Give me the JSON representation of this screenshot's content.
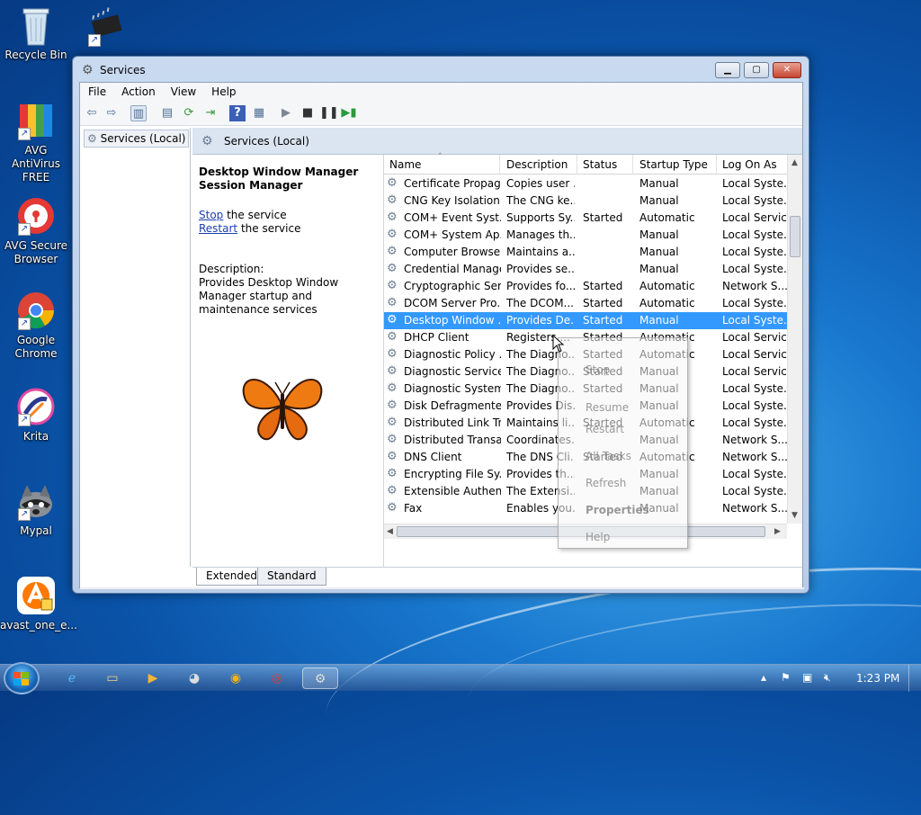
{
  "desktop": {
    "icons": [
      {
        "name": "recycle-bin",
        "label": "Recycle Bin"
      },
      {
        "name": "chip-shortcut",
        "label": ""
      },
      {
        "name": "avg-antivirus",
        "label": "AVG AntiVirus FREE"
      },
      {
        "name": "avg-secure-browser",
        "label": "AVG Secure Browser"
      },
      {
        "name": "google-chrome",
        "label": "Google Chrome"
      },
      {
        "name": "krita",
        "label": "Krita"
      },
      {
        "name": "mypal",
        "label": "Mypal"
      },
      {
        "name": "avast",
        "label": "avast_one_e..."
      }
    ]
  },
  "window": {
    "title": "Services",
    "menu": [
      "File",
      "Action",
      "View",
      "Help"
    ],
    "tree_item": "Services (Local)",
    "pane_title": "Services (Local)",
    "detail": {
      "service_title": "Desktop Window Manager Session Manager",
      "stop_link": "Stop",
      "stop_suffix": " the service",
      "restart_link": "Restart",
      "restart_suffix": " the service",
      "description_label": "Description:",
      "description_text": "Provides Desktop Window Manager startup and maintenance services"
    },
    "columns": [
      "Name",
      "Description",
      "Status",
      "Startup Type",
      "Log On As"
    ],
    "rows": [
      {
        "name": "Certificate Propag...",
        "desc": "Copies user ...",
        "status": "",
        "type": "Manual",
        "logon": "Local Syste..."
      },
      {
        "name": "CNG Key Isolation",
        "desc": "The CNG ke...",
        "status": "",
        "type": "Manual",
        "logon": "Local Syste..."
      },
      {
        "name": "COM+ Event Syst...",
        "desc": "Supports Sy...",
        "status": "Started",
        "type": "Automatic",
        "logon": "Local Service"
      },
      {
        "name": "COM+ System Ap...",
        "desc": "Manages th...",
        "status": "",
        "type": "Manual",
        "logon": "Local Syste..."
      },
      {
        "name": "Computer Browser",
        "desc": "Maintains a...",
        "status": "",
        "type": "Manual",
        "logon": "Local Syste..."
      },
      {
        "name": "Credential Manager",
        "desc": "Provides se...",
        "status": "",
        "type": "Manual",
        "logon": "Local Syste..."
      },
      {
        "name": "Cryptographic Ser...",
        "desc": "Provides fo...",
        "status": "Started",
        "type": "Automatic",
        "logon": "Network S..."
      },
      {
        "name": "DCOM Server Pro...",
        "desc": "The DCOM...",
        "status": "Started",
        "type": "Automatic",
        "logon": "Local Syste..."
      },
      {
        "name": "Desktop Window ...",
        "desc": "Provides De...",
        "status": "Started",
        "type": "Manual",
        "logon": "Local Syste..."
      },
      {
        "name": "DHCP Client",
        "desc": "Registers ...",
        "status": "Started",
        "type": "Automatic",
        "logon": "Local Service"
      },
      {
        "name": "Diagnostic Policy ...",
        "desc": "The Diagno...",
        "status": "Started",
        "type": "Automatic",
        "logon": "Local Service"
      },
      {
        "name": "Diagnostic Service...",
        "desc": "The Diagno...",
        "status": "Started",
        "type": "Manual",
        "logon": "Local Service"
      },
      {
        "name": "Diagnostic System...",
        "desc": "The Diagno...",
        "status": "Started",
        "type": "Manual",
        "logon": "Local Syste..."
      },
      {
        "name": "Disk Defragmenter",
        "desc": "Provides Dis...",
        "status": "",
        "type": "Manual",
        "logon": "Local Syste..."
      },
      {
        "name": "Distributed Link Tr...",
        "desc": "Maintains li...",
        "status": "Started",
        "type": "Automatic",
        "logon": "Local Syste..."
      },
      {
        "name": "Distributed Transa...",
        "desc": "Coordinates...",
        "status": "",
        "type": "Manual",
        "logon": "Network S..."
      },
      {
        "name": "DNS Client",
        "desc": "The DNS Cli...",
        "status": "Started",
        "type": "Automatic",
        "logon": "Network S..."
      },
      {
        "name": "Encrypting File Sy...",
        "desc": "Provides th...",
        "status": "",
        "type": "Manual",
        "logon": "Local Syste..."
      },
      {
        "name": "Extensible Authen...",
        "desc": "The Extensi...",
        "status": "",
        "type": "Manual",
        "logon": "Local Syste..."
      },
      {
        "name": "Fax",
        "desc": "Enables you...",
        "status": "",
        "type": "Manual",
        "logon": "Network S..."
      }
    ],
    "selected_row": 8,
    "context_menu": [
      "Stop",
      "Resume",
      "Restart",
      "All Tasks",
      "Refresh",
      "Properties",
      "Help"
    ],
    "tabs": [
      "Extended",
      "Standard"
    ]
  },
  "taskbar": {
    "clock": "1:23 PM"
  }
}
